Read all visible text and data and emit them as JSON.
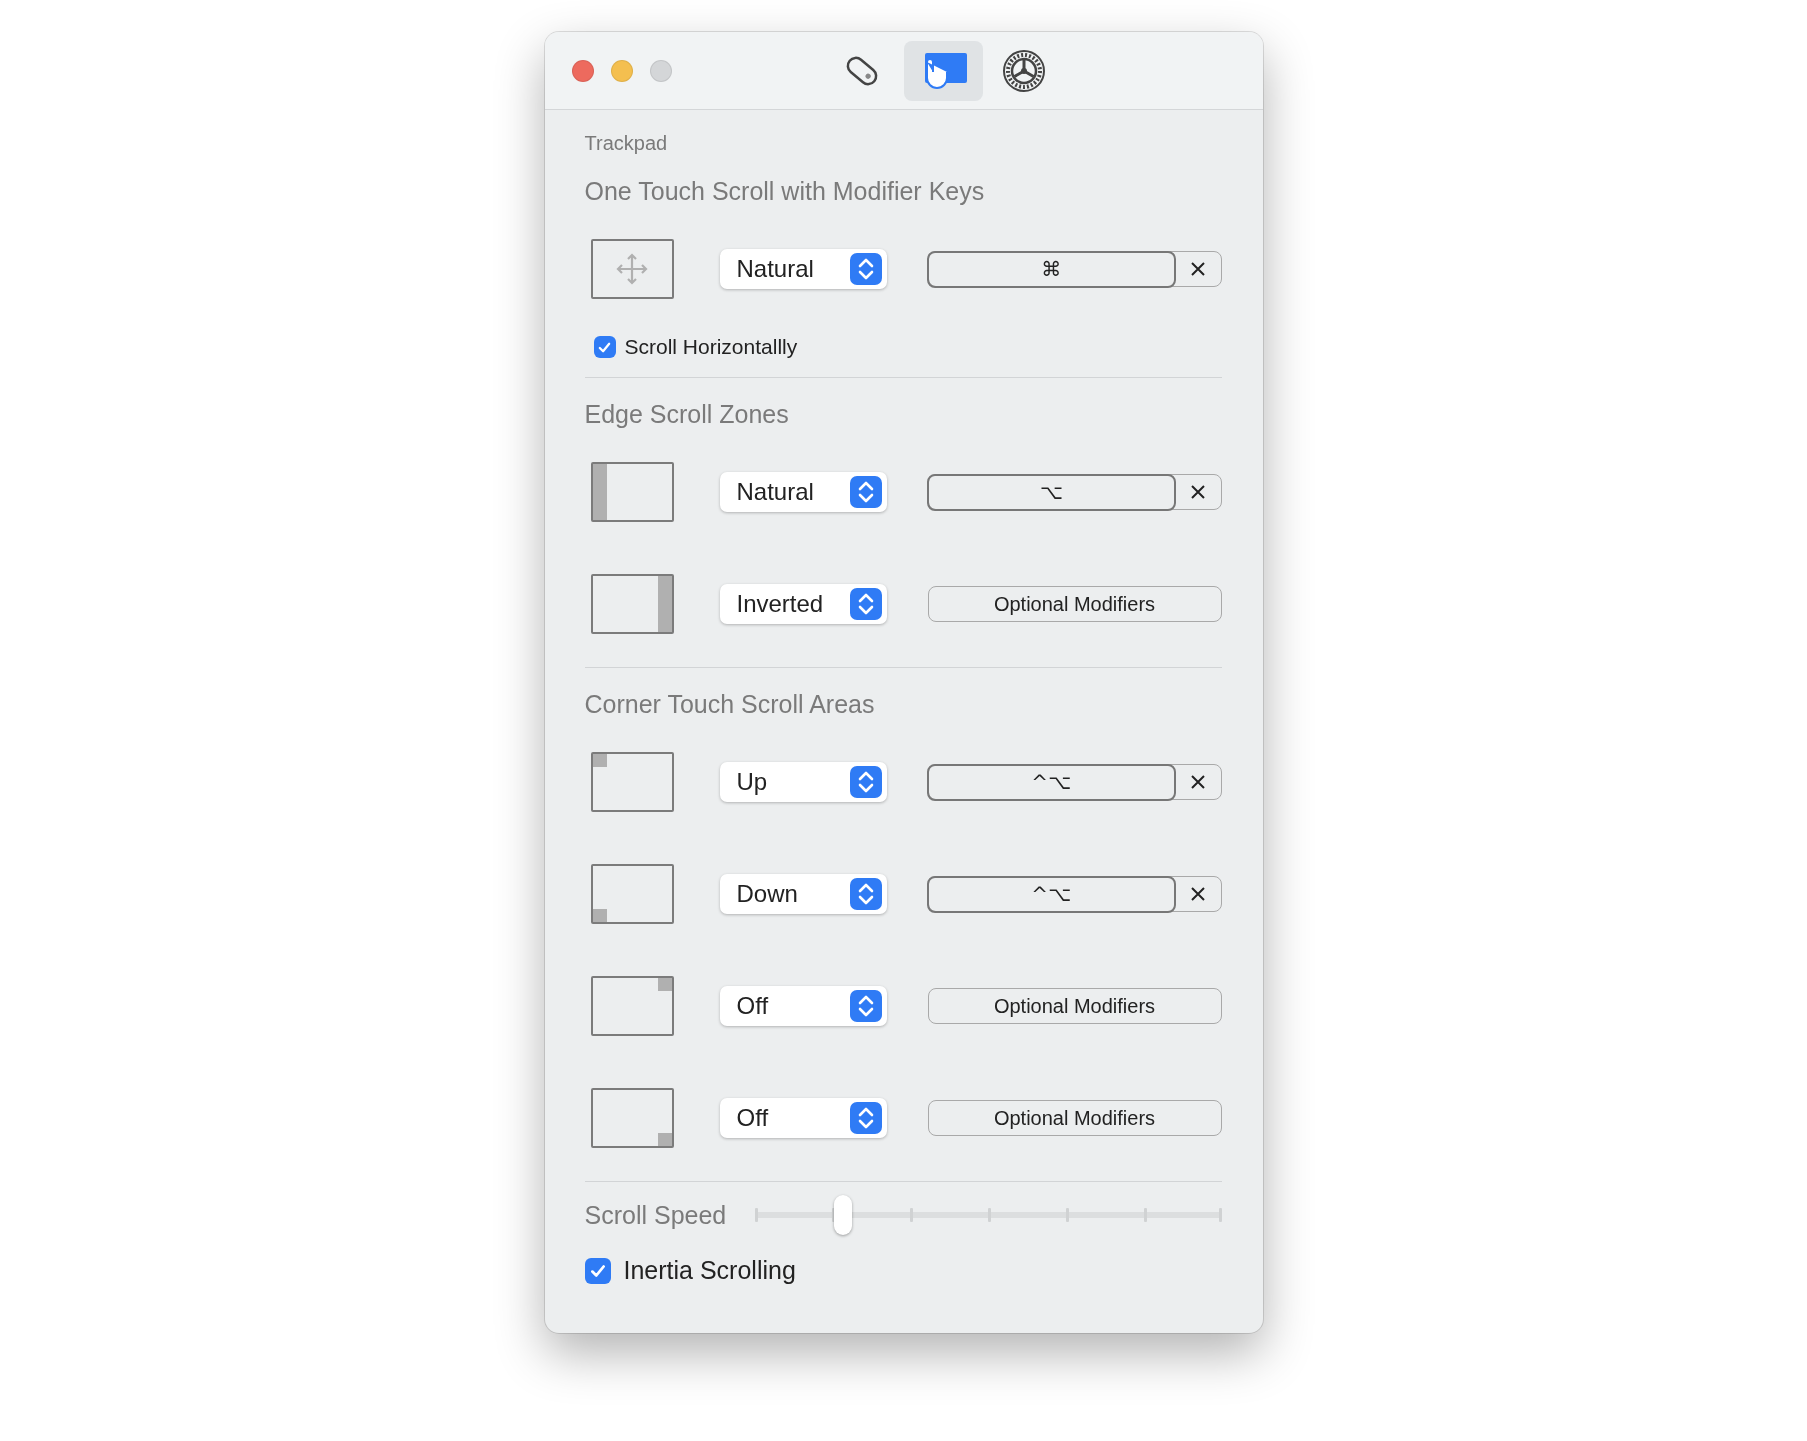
{
  "toolbar": {
    "tabs": [
      {
        "kind": "tag",
        "selected": false
      },
      {
        "kind": "trackpad",
        "selected": true
      },
      {
        "kind": "gear",
        "selected": false
      }
    ]
  },
  "pane_title": "Trackpad",
  "sections": [
    {
      "title": "One Touch Scroll with Modifier Keys",
      "rows": [
        {
          "kind": "move",
          "mode": "Natural",
          "modifier": {
            "kind": "keys",
            "keys": "⌘"
          }
        }
      ],
      "checkbox": {
        "label": "Scroll Horizontallly",
        "checked": true
      }
    },
    {
      "title": "Edge Scroll Zones",
      "rows": [
        {
          "kind": "left",
          "mode": "Natural",
          "modifier": {
            "kind": "keys",
            "keys": "⌥"
          }
        },
        {
          "kind": "right",
          "mode": "Inverted",
          "modifier": {
            "kind": "placeholder",
            "label": "Optional Modifiers"
          }
        }
      ]
    },
    {
      "title": "Corner Touch Scroll Areas",
      "rows": [
        {
          "kind": "upperleft",
          "mode": "Up",
          "modifier": {
            "kind": "keys",
            "keys": "^⌥"
          }
        },
        {
          "kind": "lowerleft",
          "mode": "Down",
          "modifier": {
            "kind": "keys",
            "keys": "^⌥"
          }
        },
        {
          "kind": "upperright",
          "mode": "Off",
          "modifier": {
            "kind": "placeholder",
            "label": "Optional Modifiers"
          }
        },
        {
          "kind": "lowerright",
          "mode": "Off",
          "modifier": {
            "kind": "placeholder",
            "label": "Optional Modifiers"
          }
        }
      ]
    }
  ],
  "scroll_speed": {
    "label": "Scroll Speed",
    "level": 0.19
  },
  "inertia": {
    "label": "Inertia Scrolling",
    "checked": true
  }
}
